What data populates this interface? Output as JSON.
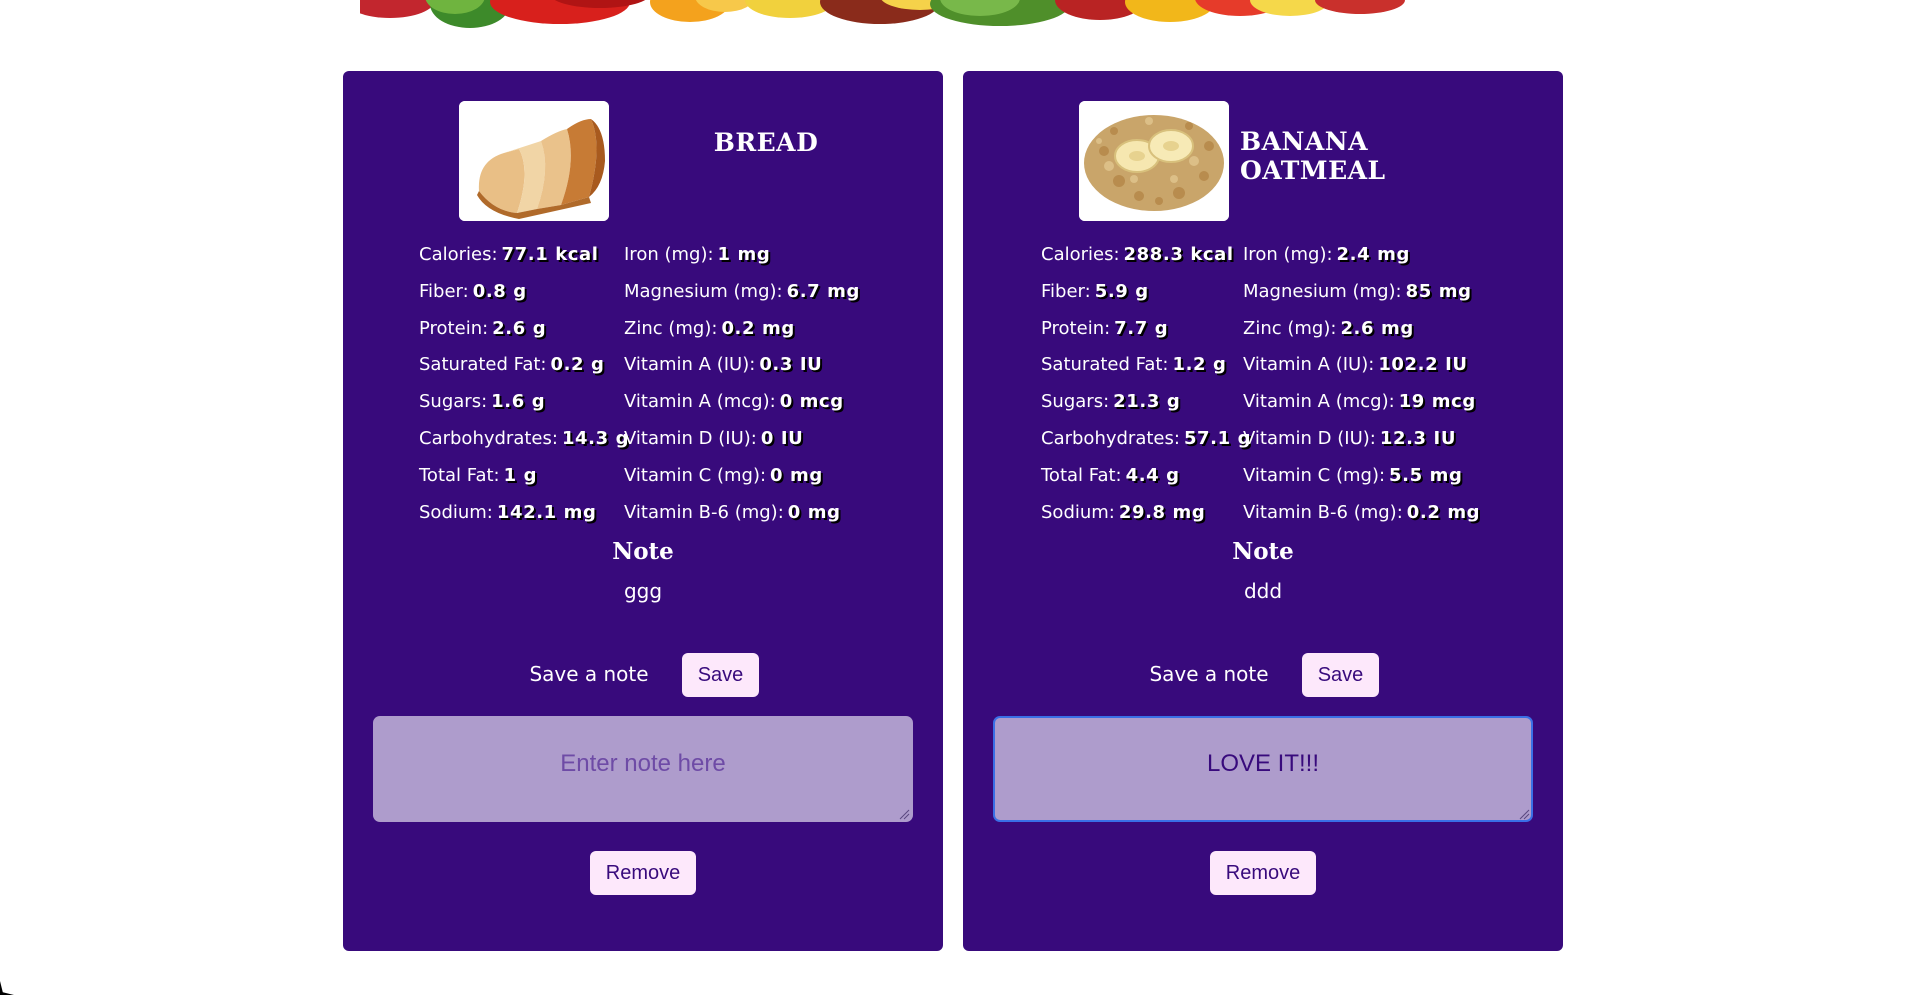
{
  "cards": [
    {
      "title_line1": "BREAD",
      "title_line2": "",
      "image_alt": "sliced bread",
      "nutrients_col1": [
        {
          "label": "Calories:",
          "value": "77.1 kcal"
        },
        {
          "label": "Fiber:",
          "value": "0.8 g"
        },
        {
          "label": "Protein:",
          "value": "2.6 g"
        },
        {
          "label": "Saturated Fat:",
          "value": "0.2 g"
        },
        {
          "label": "Sugars:",
          "value": "1.6 g"
        },
        {
          "label": "Carbohydrates:",
          "value": "14.3 g"
        },
        {
          "label": "Total Fat:",
          "value": "1 g"
        },
        {
          "label": "Sodium:",
          "value": "142.1 mg"
        }
      ],
      "nutrients_col2": [
        {
          "label": "Iron (mg):",
          "value": "1 mg"
        },
        {
          "label": "Magnesium (mg):",
          "value": "6.7 mg"
        },
        {
          "label": "Zinc (mg):",
          "value": "0.2 mg"
        },
        {
          "label": "Vitamin A (IU):",
          "value": "0.3 IU"
        },
        {
          "label": "Vitamin A (mcg):",
          "value": "0 mcg"
        },
        {
          "label": "Vitamin D (IU):",
          "value": "0 IU"
        },
        {
          "label": "Vitamin C (mg):",
          "value": "0 mg"
        },
        {
          "label": "Vitamin B-6 (mg):",
          "value": "0 mg"
        }
      ],
      "note_heading": "Note",
      "note_text": "ggg",
      "save_label": "Save a note",
      "save_button": "Save",
      "input_value": "",
      "input_placeholder": "Enter note here",
      "remove_button": "Remove"
    },
    {
      "title_line1": "BANANA",
      "title_line2": "OATMEAL",
      "image_alt": "banana oatmeal",
      "nutrients_col1": [
        {
          "label": "Calories:",
          "value": "288.3 kcal"
        },
        {
          "label": "Fiber:",
          "value": "5.9 g"
        },
        {
          "label": "Protein:",
          "value": "7.7 g"
        },
        {
          "label": "Saturated Fat:",
          "value": "1.2 g"
        },
        {
          "label": "Sugars:",
          "value": "21.3 g"
        },
        {
          "label": "Carbohydrates:",
          "value": "57.1 g"
        },
        {
          "label": "Total Fat:",
          "value": "4.4 g"
        },
        {
          "label": "Sodium:",
          "value": "29.8 mg"
        }
      ],
      "nutrients_col2": [
        {
          "label": "Iron (mg):",
          "value": "2.4 mg"
        },
        {
          "label": "Magnesium (mg):",
          "value": "85 mg"
        },
        {
          "label": "Zinc (mg):",
          "value": "2.6 mg"
        },
        {
          "label": "Vitamin A (IU):",
          "value": "102.2 IU"
        },
        {
          "label": "Vitamin A (mcg):",
          "value": "19 mcg"
        },
        {
          "label": "Vitamin D (IU):",
          "value": "12.3 IU"
        },
        {
          "label": "Vitamin C (mg):",
          "value": "5.5 mg"
        },
        {
          "label": "Vitamin B-6 (mg):",
          "value": "0.2 mg"
        }
      ],
      "note_heading": "Note",
      "note_text": "ddd",
      "save_label": "Save a note",
      "save_button": "Save",
      "input_value": "LOVE IT!!!",
      "input_placeholder": "Enter note here",
      "remove_button": "Remove"
    }
  ],
  "colors": {
    "card_bg": "#380a7c",
    "button_bg": "#fde8fb",
    "input_bg": "#ae9ccc",
    "focus_border": "#3a6fe6"
  },
  "icons": {
    "banner": "fruit-vegetable-banner-image",
    "bread": "bread-image",
    "oatmeal": "oatmeal-image",
    "grip": "resize-grip-icon"
  }
}
